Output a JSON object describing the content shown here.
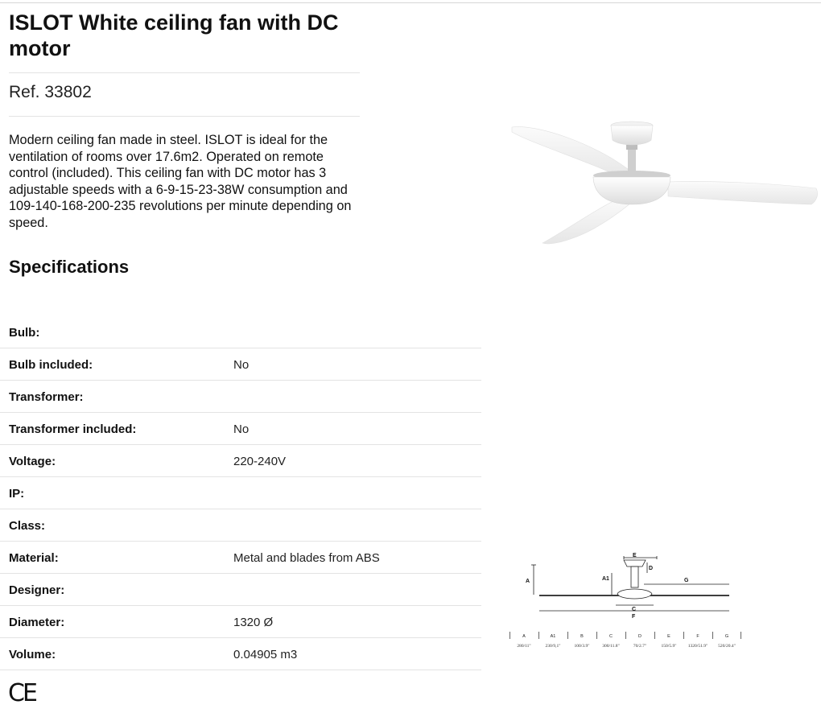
{
  "product": {
    "title": "ISLOT White ceiling fan with DC motor",
    "ref": "Ref. 33802",
    "description": "Modern ceiling fan made in steel. ISLOT is ideal for the ventilation of rooms over 17.6m2. Operated on remote control (included). This ceiling fan with DC motor has 3 adjustable speeds with a 6-9-15-23-38W consumption and 109-140-168-200-235 revolutions per minute depending on speed."
  },
  "specifications": {
    "heading": "Specifications",
    "rows": [
      {
        "label": "Bulb:",
        "value": ""
      },
      {
        "label": "Bulb included:",
        "value": "No"
      },
      {
        "label": "Transformer:",
        "value": ""
      },
      {
        "label": "Transformer included:",
        "value": "No"
      },
      {
        "label": "Voltage:",
        "value": "220-240V"
      },
      {
        "label": "IP:",
        "value": ""
      },
      {
        "label": "Class:",
        "value": ""
      },
      {
        "label": "Material:",
        "value": "Metal and blades from ABS"
      },
      {
        "label": "Designer:",
        "value": ""
      },
      {
        "label": "Diameter:",
        "value": "1320 Ø"
      },
      {
        "label": "Volume:",
        "value": "0.04905 m3"
      }
    ]
  },
  "certification": {
    "mark": "CE"
  },
  "diagram": {
    "labels": {
      "A": "A",
      "A1": "A1",
      "C": "C",
      "D": "D",
      "E": "E",
      "F": "F",
      "G": "G"
    },
    "dimensions": [
      {
        "head": "A",
        "value": "280/11\""
      },
      {
        "head": "A1",
        "value": "230/9,1\""
      },
      {
        "head": "B",
        "value": "100/3.9\""
      },
      {
        "head": "C",
        "value": "300/11.8\""
      },
      {
        "head": "D",
        "value": "70/2.7\""
      },
      {
        "head": "E",
        "value": "150/5.9\""
      },
      {
        "head": "F",
        "value": "1320/51.9\""
      },
      {
        "head": "G",
        "value": "520/20.4\""
      }
    ]
  },
  "colors": {
    "text": "#111111",
    "rule": "#e3e3e3",
    "fan_white": "#f4f4f4"
  }
}
